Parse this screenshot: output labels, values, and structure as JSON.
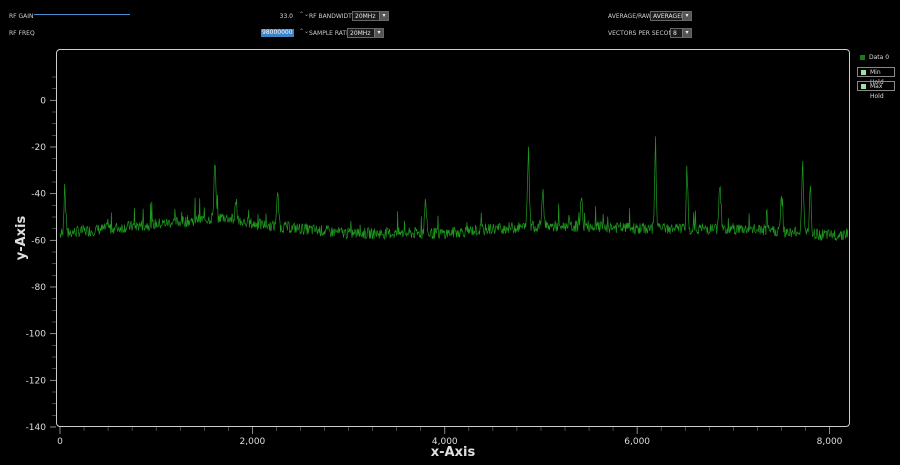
{
  "controls": {
    "rf_gain": {
      "label": "RF GAIN",
      "value": "33.0",
      "slider_fraction": 0.6
    },
    "rf_freq": {
      "label": "RF FREQ",
      "value": "98000000"
    },
    "rf_bandwidth": {
      "label": "RF BANDWIDTH:",
      "value": "20MHz"
    },
    "sample_rate": {
      "label": "SAMPLE RATE:",
      "value": "20MHz"
    },
    "average_raw": {
      "label": "AVERAGE/RAW:",
      "value": "AVERAGED"
    },
    "vectors_per_second": {
      "label": "VECTORS PER SECOND:",
      "value": "8"
    },
    "spinner_glyph": "⌃⌄",
    "dropdown_glyph": "▾"
  },
  "legend": [
    {
      "label": "Data 0",
      "color": "#1a7a1a"
    },
    {
      "label": "Min Hold",
      "color": "#9fe09f"
    },
    {
      "label": "Max Hold",
      "color": "#9fe09f"
    }
  ],
  "chart_data": {
    "type": "line",
    "xlabel": "x-Axis",
    "ylabel": "y-Axis",
    "xlim": [
      0,
      8192
    ],
    "ylim": [
      -140,
      10
    ],
    "xticks": [
      0,
      2000,
      4000,
      6000,
      8000
    ],
    "xtick_labels": [
      "0",
      "2,000",
      "4,000",
      "6,000",
      "8,000"
    ],
    "yticks": [
      0,
      -20,
      -40,
      -60,
      -80,
      -100,
      -120,
      -140
    ],
    "ytick_labels": [
      "0",
      "-20",
      "-40",
      "-60",
      "-80",
      "-100",
      "-120",
      "-140"
    ],
    "line_color": "#1f9a1f",
    "series": [
      {
        "name": "Data 0",
        "baseline": [
          [
            0,
            -57
          ],
          [
            500,
            -55
          ],
          [
            1000,
            -53
          ],
          [
            1500,
            -51
          ],
          [
            1700,
            -50
          ],
          [
            2000,
            -53
          ],
          [
            2500,
            -55
          ],
          [
            3000,
            -57
          ],
          [
            3500,
            -57
          ],
          [
            4000,
            -57
          ],
          [
            4500,
            -55
          ],
          [
            5000,
            -54
          ],
          [
            5500,
            -54
          ],
          [
            6000,
            -55
          ],
          [
            6500,
            -55
          ],
          [
            7000,
            -55
          ],
          [
            7500,
            -56
          ],
          [
            8000,
            -58
          ],
          [
            8192,
            -57
          ]
        ],
        "peaks": [
          [
            50,
            -40
          ],
          [
            1610,
            -26
          ],
          [
            1830,
            -43
          ],
          [
            2260,
            -38
          ],
          [
            3800,
            -42
          ],
          [
            4870,
            -17
          ],
          [
            5020,
            -37
          ],
          [
            5420,
            -39
          ],
          [
            6190,
            -19
          ],
          [
            6520,
            -31
          ],
          [
            6860,
            -34
          ],
          [
            7500,
            -40
          ],
          [
            7720,
            -24
          ],
          [
            7800,
            -36
          ]
        ]
      }
    ]
  }
}
